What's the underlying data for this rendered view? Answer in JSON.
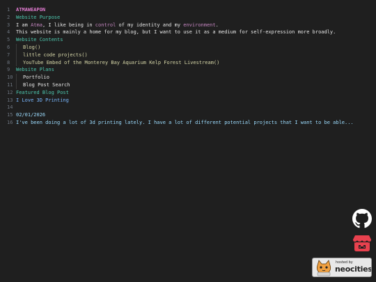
{
  "lines": [
    {
      "n": "1",
      "text": "ATMAWEAPON"
    },
    {
      "n": "2",
      "text": "Website Purpose"
    },
    {
      "n": "3",
      "parts": [
        "I am ",
        "Atma",
        ", I like being in ",
        "control",
        " of my identity and my ",
        "environment",
        "."
      ]
    },
    {
      "n": "4",
      "text": "This website is mainly a home for my blog, but I want to use it as a medium for self-expression more broadly."
    },
    {
      "n": "5",
      "text": "Website Contents"
    },
    {
      "n": "6",
      "text": "Blog()"
    },
    {
      "n": "7",
      "text": "little code projects()"
    },
    {
      "n": "8",
      "text": "YouTube Embed of the Monterey Bay Aquarium Kelp Forest Livestream()"
    },
    {
      "n": "9",
      "text": "Website Plans"
    },
    {
      "n": "10",
      "text": "Portfolio"
    },
    {
      "n": "11",
      "text": "Blog Post Search"
    },
    {
      "n": "12",
      "text": "Featured Blog Post"
    },
    {
      "n": "13",
      "text": "I Love 3D Printing"
    },
    {
      "n": "14",
      "text": ""
    },
    {
      "n": "15",
      "text": "02/01/2026"
    },
    {
      "n": "16",
      "text": "I've been doing a lot of 3d printing lately. I have a lot of different potential projects that I want to be able..."
    }
  ],
  "social": {
    "github_icon": "github-icon",
    "itch_icon": "itchio-icon"
  },
  "badge": {
    "small_text": "hosted by",
    "big_text": "neocities"
  },
  "colors": {
    "background": "#1f1f1f",
    "title": "#e07bd0",
    "heading": "#4ec9b0",
    "itch": "#e8414e"
  }
}
